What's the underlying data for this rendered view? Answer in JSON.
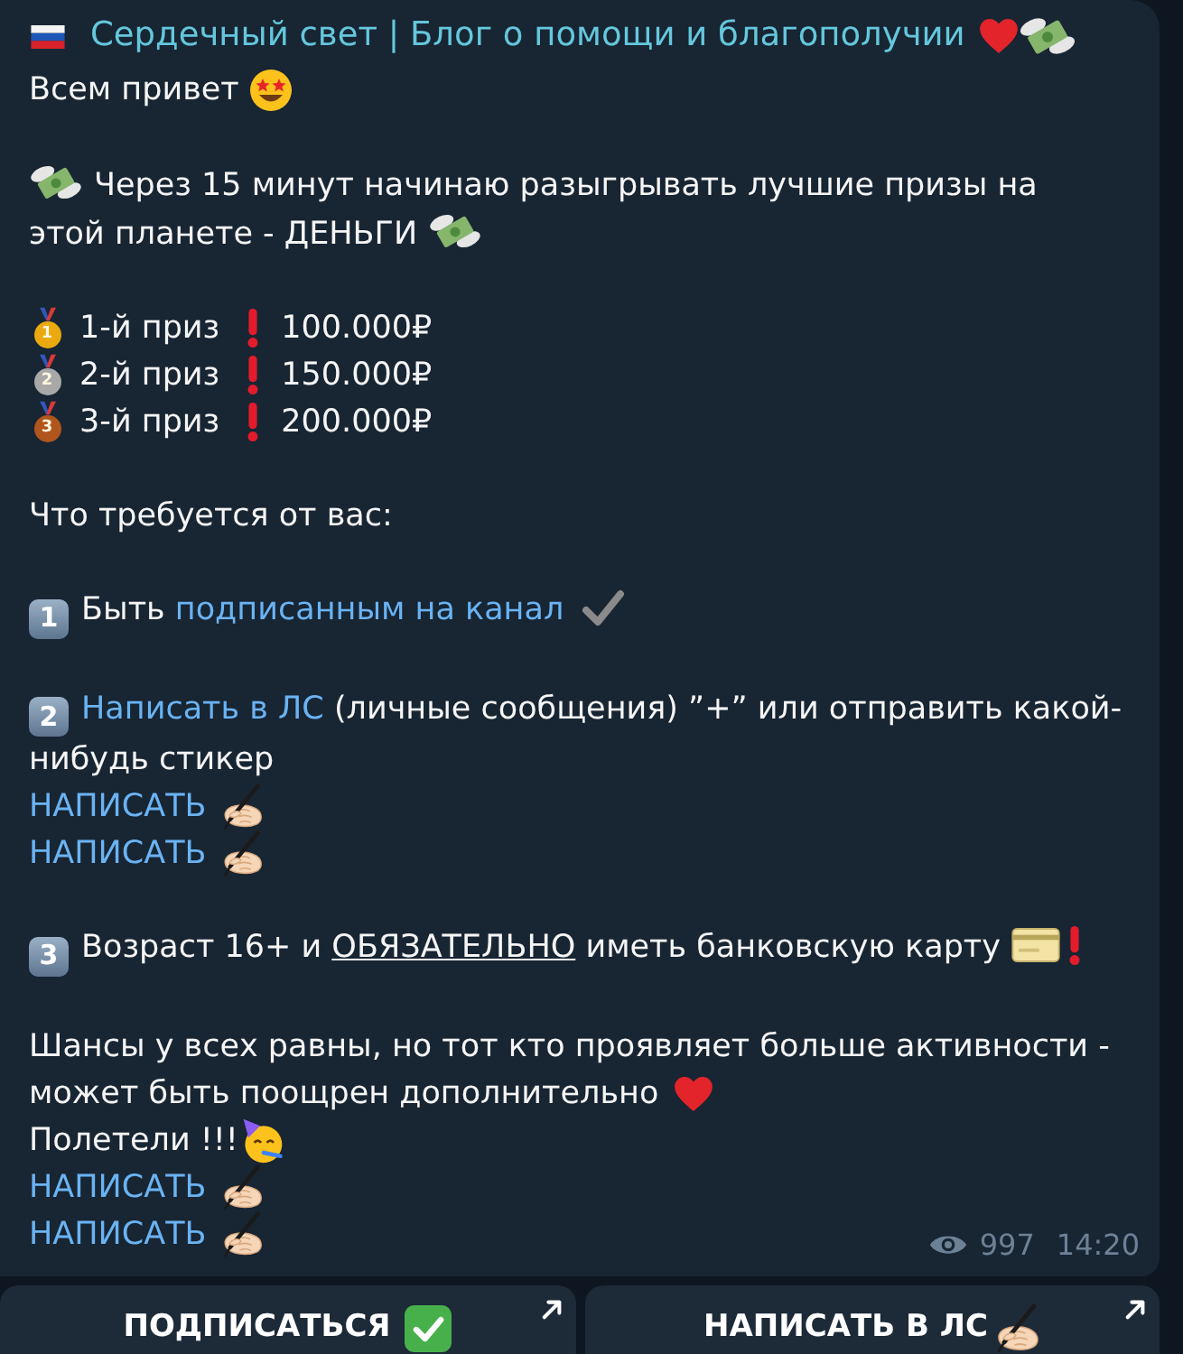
{
  "header": {
    "title": "Сердечный свет | Блог о помощи и благополучии"
  },
  "greeting": "Всем привет",
  "announcement": "Через 15 минут начинаю разыгрывать лучшие призы на этой планете - ДЕНЬГИ",
  "prizes": [
    {
      "medal": "1",
      "color": "#e9a90f",
      "label": "1-й приз",
      "amount": "100.000₽"
    },
    {
      "medal": "2",
      "color": "#a8a8a8",
      "label": "2-й приз",
      "amount": "150.000₽"
    },
    {
      "medal": "3",
      "color": "#b0561c",
      "label": "3-й приз",
      "amount": "200.000₽"
    }
  ],
  "requirements_heading": "Что требуется от вас:",
  "requirements": [
    {
      "number": "1",
      "segments": [
        {
          "kind": "text",
          "text": "Быть "
        },
        {
          "kind": "link",
          "text": "подписанным на канал"
        }
      ]
    },
    {
      "number": "2",
      "segments": [
        {
          "kind": "link",
          "text": "Написать в ЛС"
        },
        {
          "kind": "text",
          "text": " (личные сообщения) ”+” или отправить какой-нибудь стикер"
        }
      ],
      "links": [
        "НАПИСАТЬ",
        "НАПИСАТЬ"
      ]
    },
    {
      "number": "3",
      "segments": [
        {
          "kind": "text",
          "text": "Возраст 16+ и "
        },
        {
          "kind": "underline",
          "text": "ОБЯЗАТЕЛЬНО"
        },
        {
          "kind": "text",
          "text": " иметь банковскую карту"
        }
      ]
    }
  ],
  "closing": "Шансы у всех равны, но тот кто проявляет больше активности - может быть поощрен дополнительно",
  "cheer": "Полетели !!!",
  "closing_links": [
    "НАПИСАТЬ",
    "НАПИСАТЬ"
  ],
  "footer": {
    "views": "997",
    "time": "14:20"
  },
  "buttons": [
    {
      "label": "ПОДПИСАТЬСЯ"
    },
    {
      "label": "НАПИСАТЬ В ЛС"
    }
  ]
}
